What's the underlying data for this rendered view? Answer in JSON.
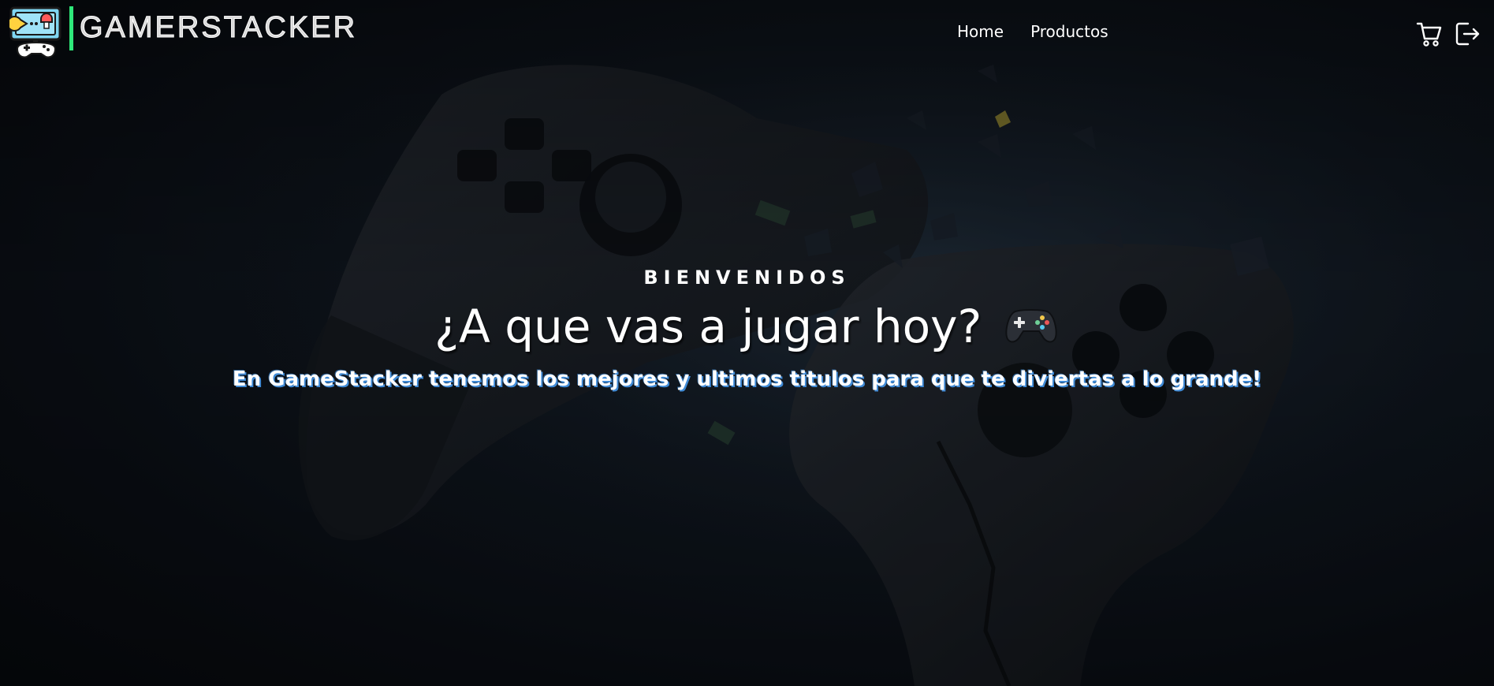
{
  "brand": {
    "name": "GAMERSTACKER",
    "logo_icon": "arcade-controller-logo-icon",
    "accent_color": "#2ee87a"
  },
  "nav": {
    "links": [
      {
        "label": "Home"
      },
      {
        "label": "Productos"
      }
    ],
    "icons": [
      {
        "name": "cart-icon"
      },
      {
        "name": "logout-icon"
      }
    ]
  },
  "hero": {
    "kicker": "BIENVENIDOS",
    "title": "¿A que vas a jugar hoy?",
    "title_emoji": "🎮",
    "subtitle": "En GameStacker tenemos los mejores y ultimos titulos para que te diviertas a lo grande!",
    "background": "exploding-game-controller-image"
  }
}
